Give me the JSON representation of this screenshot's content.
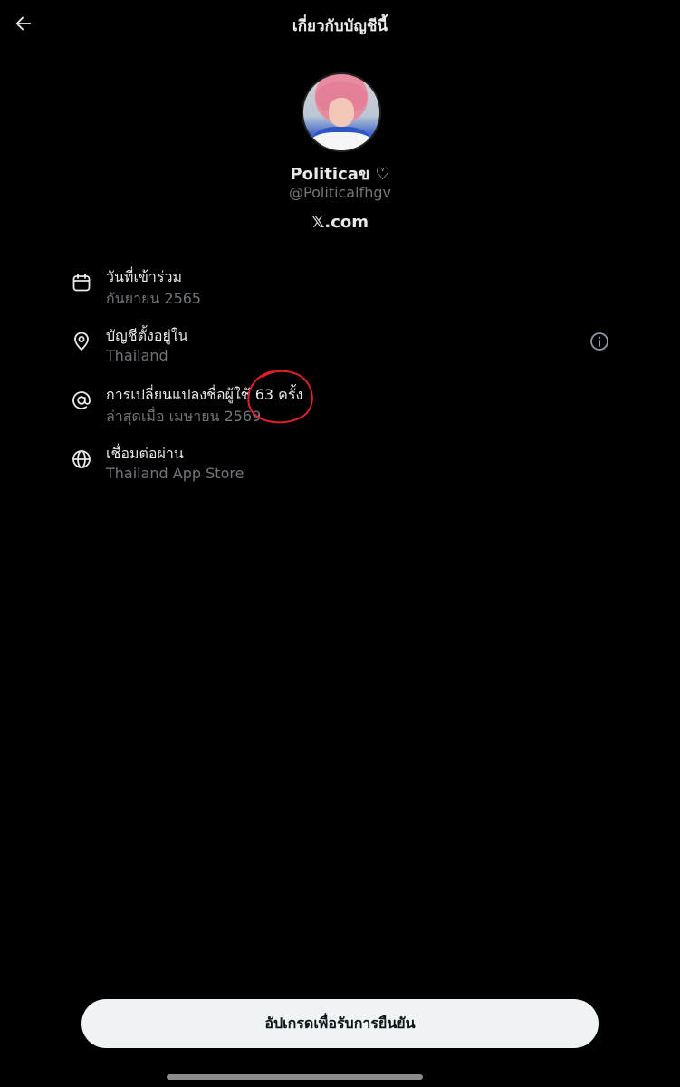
{
  "header": {
    "title": "เกี่ยวกับบัญชีนี้",
    "back_icon": "arrow-left-icon"
  },
  "profile": {
    "display_name": "Politicaข ♡",
    "handle": "@Politicalfhgv",
    "site": "𝕏.com"
  },
  "details": [
    {
      "icon": "calendar-icon",
      "label": "วันที่เข้าร่วม",
      "value": "กันยายน 2565"
    },
    {
      "icon": "location-pin-icon",
      "label": "บัญชีตั้งอยู่ใน",
      "value": "Thailand",
      "info_icon": "info-icon"
    },
    {
      "icon": "at-sign-icon",
      "label": "การเปลี่ยนแปลงชื่อผู้ใช้ 63 ครั้ง",
      "value": "ล่าสุดเมื่อ เมษายน 2569"
    },
    {
      "icon": "globe-icon",
      "label": "เชื่อมต่อผ่าน",
      "value": "Thailand App Store"
    }
  ],
  "annotation_color": "#e0202a",
  "cta": {
    "label": "อัปเกรดเพื่อรับการยืนยัน"
  },
  "colors": {
    "background": "#000000",
    "primary_text": "#e7e9ea",
    "secondary_text": "#71767b",
    "button_bg": "#eff3f4"
  }
}
